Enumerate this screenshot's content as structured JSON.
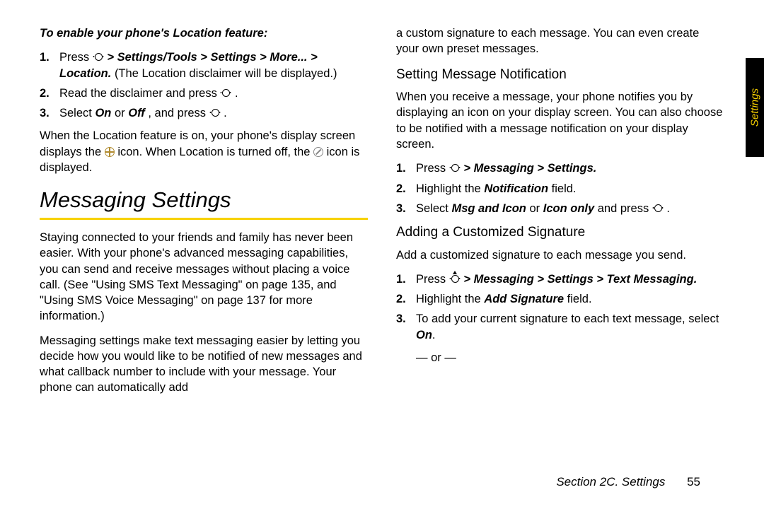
{
  "tab_label": "Settings",
  "footer_section": "Section 2C. Settings",
  "footer_page": "55",
  "left": {
    "enable_title": "To enable your phone's Location feature:",
    "steps": {
      "s1a": "Press ",
      "s1b": " > Settings/Tools > Settings > More... > Location.",
      "s1c": " (The Location disclaimer will be displayed.)",
      "s2a": "Read the disclaimer and press ",
      "s2b": ".",
      "s3a": "Select ",
      "s3on": "On",
      "s3or": " or ",
      "s3off": "Off",
      "s3b": ", and press ",
      "s3c": "."
    },
    "para_a": "When the Location feature is on, your phone's display screen displays the ",
    "para_b": " icon. When Location is turned off, the ",
    "para_c": " icon is displayed.",
    "h1": "Messaging Settings",
    "intro1": "Staying connected to your friends and family has never been easier. With your phone's advanced messaging capabilities, you can send and receive messages without placing a voice call. (See \"Using SMS Text Messaging\" on page 135, and \"Using SMS Voice Messaging\" on page 137 for more information.)",
    "intro2": "Messaging settings make text messaging easier by letting you decide how you would like to be notified of new messages and what callback number to include with your message. Your phone can automatically add"
  },
  "right": {
    "cont": "a custom signature to each message. You can even create your own preset messages.",
    "h2a": "Setting Message Notification",
    "notif_para": "When you receive a message, your phone notifies you by displaying an icon on your display screen. You can also choose to be notified with a message notification on your display screen.",
    "n1a": "Press ",
    "n1b": " > Messaging > Settings.",
    "n2a": "Highlight the ",
    "n2b": "Notification",
    "n2c": " field.",
    "n3a": "Select ",
    "n3b": "Msg and Icon",
    "n3c": " or ",
    "n3d": "Icon only",
    "n3e": " and press ",
    "n3f": ".",
    "h2b": "Adding a Customized Signature",
    "sig_para": "Add a customized signature to each message you send.",
    "g1a": "Press ",
    "g1b": "  > Messaging > Settings > Text Messaging.",
    "g2a": "Highlight the ",
    "g2b": "Add Signature",
    "g2c": " field.",
    "g3": "To add your current signature to each text message, select ",
    "g3on": "On",
    "g3dot": ".",
    "or": "— or —"
  }
}
